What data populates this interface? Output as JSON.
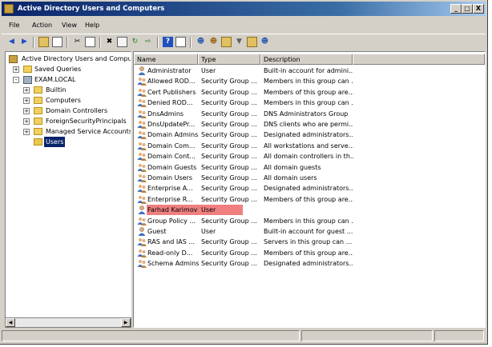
{
  "window": {
    "title": "Active Directory Users and Computers",
    "controls": {
      "minimize": "_",
      "maximize": "□",
      "close": "X"
    }
  },
  "menu": [
    "File",
    "Action",
    "View",
    "Help"
  ],
  "toolbar_icons": [
    "back-icon",
    "forward-icon",
    "up-icon",
    "show-hide-tree-icon",
    "cut-icon",
    "copy-icon",
    "delete-icon",
    "properties-icon",
    "refresh-icon",
    "export-icon",
    "help-icon",
    "console-icon",
    "new-user-icon",
    "new-group-icon",
    "new-ou-icon",
    "filter-icon",
    "add-to-group-icon",
    "find-icon"
  ],
  "tree": {
    "root": "Active Directory Users and Comput",
    "items": [
      {
        "label": "Saved Queries",
        "level": 1,
        "expander": "+"
      },
      {
        "label": "EXAM.LOCAL",
        "level": 1,
        "expander": "-"
      },
      {
        "label": "Builtin",
        "level": 2,
        "expander": "+"
      },
      {
        "label": "Computers",
        "level": 2,
        "expander": "+"
      },
      {
        "label": "Domain Controllers",
        "level": 2,
        "expander": "+"
      },
      {
        "label": "ForeignSecurityPrincipals",
        "level": 2,
        "expander": "+"
      },
      {
        "label": "Managed Service Accounts",
        "level": 2,
        "expander": "+"
      },
      {
        "label": "Users",
        "level": 2,
        "expander": "",
        "selected": true
      }
    ]
  },
  "list": {
    "columns": [
      "Name",
      "Type",
      "Description"
    ],
    "rows": [
      {
        "name": "Administrator",
        "type": "User",
        "description": "Built-in account for admini...",
        "icon": "user"
      },
      {
        "name": "Allowed ROD...",
        "type": "Security Group ...",
        "description": "Members in this group can ...",
        "icon": "group"
      },
      {
        "name": "Cert Publishers",
        "type": "Security Group ...",
        "description": "Members of this group are...",
        "icon": "group"
      },
      {
        "name": "Denied ROD...",
        "type": "Security Group ...",
        "description": "Members in this group can ...",
        "icon": "group"
      },
      {
        "name": "DnsAdmins",
        "type": "Security Group ...",
        "description": "DNS Administrators Group",
        "icon": "group"
      },
      {
        "name": "DnsUpdatePr...",
        "type": "Security Group ...",
        "description": "DNS clients who are permi...",
        "icon": "group"
      },
      {
        "name": "Domain Admins",
        "type": "Security Group ...",
        "description": "Designated administrators...",
        "icon": "group"
      },
      {
        "name": "Domain Com...",
        "type": "Security Group ...",
        "description": "All workstations and serve...",
        "icon": "group"
      },
      {
        "name": "Domain Cont...",
        "type": "Security Group ...",
        "description": "All domain controllers in th...",
        "icon": "group"
      },
      {
        "name": "Domain Guests",
        "type": "Security Group ...",
        "description": "All domain guests",
        "icon": "group"
      },
      {
        "name": "Domain Users",
        "type": "Security Group ...",
        "description": "All domain users",
        "icon": "group"
      },
      {
        "name": "Enterprise A...",
        "type": "Security Group ...",
        "description": "Designated administrators...",
        "icon": "group"
      },
      {
        "name": "Enterprise R...",
        "type": "Security Group ...",
        "description": "Members of this group are...",
        "icon": "group"
      },
      {
        "name": "Farhad Karimov",
        "type": "User",
        "description": "",
        "icon": "user",
        "highlighted": true
      },
      {
        "name": "Group Policy ...",
        "type": "Security Group ...",
        "description": "Members in this group can ...",
        "icon": "group"
      },
      {
        "name": "Guest",
        "type": "User",
        "description": "Built-in account for guest ...",
        "icon": "user"
      },
      {
        "name": "RAS and IAS ...",
        "type": "Security Group ...",
        "description": "Servers in this group can ...",
        "icon": "group"
      },
      {
        "name": "Read-only D...",
        "type": "Security Group ...",
        "description": "Members of this group are...",
        "icon": "group"
      },
      {
        "name": "Schema Admins",
        "type": "Security Group ...",
        "description": "Designated administrators...",
        "icon": "group"
      }
    ]
  },
  "colors": {
    "highlight": "#f08080",
    "titlebar": "#0a246a",
    "selection": "#0a246a"
  }
}
